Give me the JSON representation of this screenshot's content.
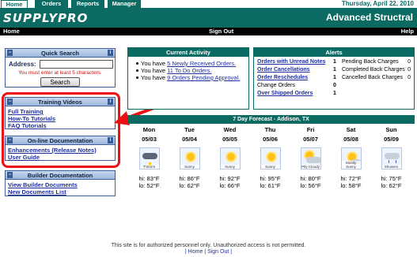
{
  "top_tabs": [
    {
      "label": "Home",
      "active": true
    },
    {
      "label": "Orders",
      "active": false
    },
    {
      "label": "Reports",
      "active": false
    },
    {
      "label": "Manager",
      "active": false
    }
  ],
  "date": "Thursday, April 22, 2010",
  "logo": "SUPPLYPRO",
  "site_title": "Advanced Structral",
  "nav": {
    "home": "Home",
    "sign_out": "Sign Out",
    "help": "Help"
  },
  "quick_search": {
    "title": "Quick Search",
    "address_label": "Address:",
    "address_value": "",
    "hint": "You must enter at least 5 characters.",
    "button": "Search"
  },
  "training": {
    "title": "Training Videos",
    "links": [
      "Full Training",
      "How-To Tutorials",
      "FAQ Tutorials"
    ]
  },
  "online_doc": {
    "title": "On-line Documentation",
    "links": [
      "Enhancements (Release Notes)",
      "User Guide"
    ]
  },
  "builder_doc": {
    "title": "Builder Documentation",
    "links": [
      "View Builder Documents",
      "New Documents List"
    ]
  },
  "activity": {
    "title": "Current Activity",
    "items": [
      {
        "prefix": "You have ",
        "link": "5 Newly Received Orders."
      },
      {
        "prefix": "You have ",
        "link": "11 To Do Orders."
      },
      {
        "prefix": "You have ",
        "link": "9 Orders Pending Approval."
      }
    ]
  },
  "alerts": {
    "title": "Alerts",
    "rows": [
      {
        "label": "Orders with Unread Notes",
        "count": "1",
        "pb": "Pending Back Charges",
        "pb_count": "0",
        "is_link": true
      },
      {
        "label": "Order Cancellations",
        "count": "1",
        "pb": "Completed Back Charges",
        "pb_count": "0",
        "is_link": true
      },
      {
        "label": "Order Reschedules",
        "count": "1",
        "pb": "Cancelled Back Charges",
        "pb_count": "0",
        "is_link": true
      },
      {
        "label": "Change Orders",
        "count": "0",
        "pb": "",
        "pb_count": "",
        "is_link": false
      },
      {
        "label": "Over Shipped Orders",
        "count": "1",
        "pb": "",
        "pb_count": "",
        "is_link": true
      }
    ]
  },
  "forecast": {
    "title": "7 Day Forecast  -  Addison, TX",
    "days": [
      {
        "day": "Mon",
        "date": "05/03",
        "desc": "T'Storm",
        "icon": "thunderstorm-icon",
        "hi": "hi: 83°F",
        "lo": "lo: 52°F"
      },
      {
        "day": "Tue",
        "date": "05/04",
        "desc": "Sunny",
        "icon": "sunny-icon",
        "hi": "hi: 86°F",
        "lo": "lo: 62°F"
      },
      {
        "day": "Wed",
        "date": "05/05",
        "desc": "Sunny",
        "icon": "sunny-icon",
        "hi": "hi: 92°F",
        "lo": "lo: 66°F"
      },
      {
        "day": "Thu",
        "date": "05/06",
        "desc": "Sunny",
        "icon": "sunny-icon",
        "hi": "hi: 95°F",
        "lo": "lo: 61°F"
      },
      {
        "day": "Fri",
        "date": "05/07",
        "desc": "Ptly Cloudy",
        "icon": "partly-cloudy-icon",
        "hi": "hi: 80°F",
        "lo": "lo: 56°F"
      },
      {
        "day": "Sat",
        "date": "05/08",
        "desc": "Mostly Sunny",
        "icon": "mostly-sunny-icon",
        "hi": "hi: 72°F",
        "lo": "lo: 58°F"
      },
      {
        "day": "Sun",
        "date": "05/09",
        "desc": "Showers",
        "icon": "showers-icon",
        "hi": "hi: 75°F",
        "lo": "lo: 62°F"
      }
    ]
  },
  "footer": {
    "note": "This site is for authorized personnel only. Unauthorized access is not permitted.",
    "links": "| Home | Sign Out |"
  },
  "colors": {
    "brand": "#0b6b63",
    "link": "#1f2f9c",
    "highlight": "#ee1111"
  }
}
